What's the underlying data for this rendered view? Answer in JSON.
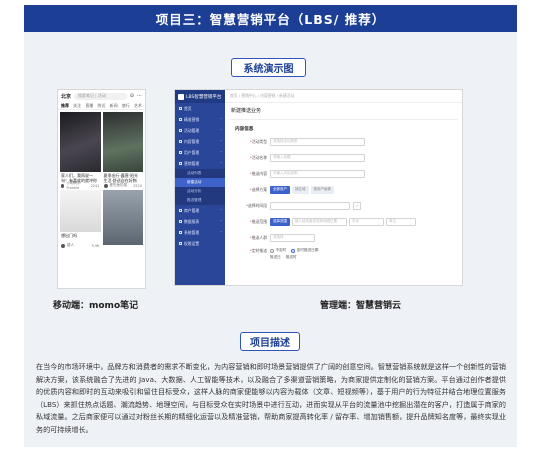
{
  "header": {
    "title": "项目三：智慧营销平台（LBS/ 推荐）"
  },
  "section_demo": {
    "title": "系统演示图"
  },
  "section_desc": {
    "title": "项目描述"
  },
  "captions": {
    "mobile": "移动端：momo笔记",
    "admin": "管理端：智慧营销云"
  },
  "description": "在当今的市场环境中，品牌方和消费者的需求不断变化，为内容营销和即时场景营销提供了广阔的创意空间。智慧营销系统就是这样一个创新性的营销解决方案，该系统融合了先进的 Java、大数据、人工智能等技术，以及融合了多渠道营销策略，为商家提供定制化的营销方案。平台通过创作者提供的优质内容和即时的互动来吸引和留住目标受众，这样人脉的商家便能够以内容为载体（文章、短视频等），基于用户的行为特征并结合地理位置服务（LBS）来抓住热点话题、潮流趋势、地理空间，与目标受众在实时场景中进行互动，进而实现从平台的流量池中挖掘出潜在的客户，打造属于商家的私域流量。之后商家便可以通过对粉丝长期的精细化运营以及精准营销，帮助商家提高转化率 / 留存率、增加销售额，提升品牌知名度等，最终实现业务的可持续增长。",
  "mobile": {
    "city": "北京",
    "search_placeholder": "搜索笔记 | 活动",
    "tabs": [
      "推荐",
      "关注",
      "直播",
      "附近",
      "新闻",
      "旅行",
      "艺术"
    ],
    "cards": [
      {
        "title": "家人们，我再说一句！有喜欢的就冲你们的体验",
        "user": "小明同学 Frankie",
        "likes": "2241",
        "img": "#3d3f45"
      },
      {
        "title": "夏季出行·露营·阳光生活·舒适自在好物",
        "user": "爱吃鱼的猫",
        "likes": "2520",
        "img": "#5b6a5a"
      },
      {
        "title": "想出门吗",
        "user": "路人",
        "likes": "9.9K",
        "img": "#e8e8e8"
      },
      {
        "title": "",
        "user": "",
        "likes": "",
        "img": "#707a86"
      }
    ]
  },
  "admin": {
    "brand": "LBS智慧营销平台",
    "breadcrumb": "首页 / 营销中心 / 内容营销 / 新建活动",
    "page_title": "新建推送业务",
    "sidebar": [
      {
        "label": "首页"
      },
      {
        "label": "精准营销"
      },
      {
        "label": "活动管理"
      },
      {
        "label": "内容管理"
      },
      {
        "label": "用户管理"
      },
      {
        "label": "营销管理",
        "subs": [
          "活动列表",
          "新建活动",
          "活动分析",
          "推送管理"
        ]
      },
      {
        "label": "商户管理"
      },
      {
        "label": "数据报表"
      },
      {
        "label": "系统管理"
      },
      {
        "label": "权限设置"
      }
    ],
    "form": {
      "section": "内容信息",
      "fields": [
        {
          "label": "活动类型",
          "value": "请选择活动类型"
        },
        {
          "label": "活动名称",
          "value": "请输入标题"
        },
        {
          "label": "推送内容",
          "value": "可输入内容说明"
        },
        {
          "label": "选择方案",
          "buttons": [
            "全部用户",
            "按区域",
            "按用户画像"
          ]
        },
        {
          "label": "选择时间段",
          "value": ""
        },
        {
          "label": "推送范围",
          "buttons": [
            "选择范围"
          ],
          "value": "输入经纬度或选择地图位置",
          "value2": "半径",
          "value3": "单位"
        },
        {
          "label": "推送人群",
          "value": "请选择"
        },
        {
          "label": "定时推送",
          "radios": [
            "不定时",
            "定时推送日期"
          ],
          "extra": [
            "推送日",
            "推送时"
          ]
        }
      ]
    }
  }
}
